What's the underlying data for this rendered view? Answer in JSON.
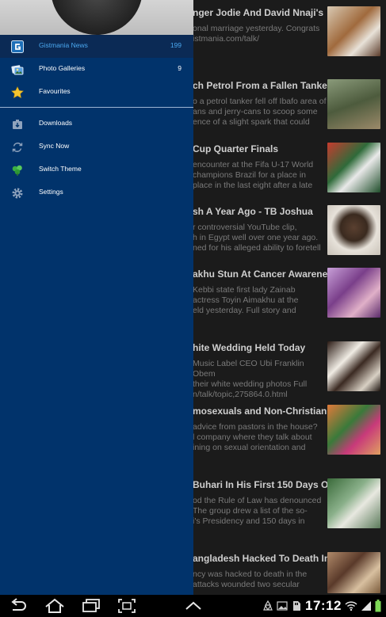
{
  "drawer": {
    "items": [
      {
        "label": "Gistmania News",
        "count": "199",
        "icon": "gistmania-icon",
        "active": true
      },
      {
        "label": "Photo Galleries",
        "count": "9",
        "icon": "photo-galleries-icon"
      },
      {
        "label": "Favourites",
        "count": "",
        "icon": "star-icon"
      },
      {
        "label": "Downloads",
        "count": "",
        "icon": "download-icon"
      },
      {
        "label": "Sync Now",
        "count": "",
        "icon": "sync-icon"
      },
      {
        "label": "Switch Theme",
        "count": "",
        "icon": "theme-icon"
      },
      {
        "label": "Settings",
        "count": "",
        "icon": "settings-icon"
      }
    ]
  },
  "feed": {
    "articles": [
      {
        "headline": "nger Jodie And David Nnaji's",
        "snippet": "onal marriage yesterday. Congrats\nistmania.com/talk/"
      },
      {
        "headline": "ch Petrol From a Fallen Tanker",
        "snippet": "o a petrol tanker fell off Ibafo area of\nans and jerry-cans to scoop some\nence of a slight spark that could"
      },
      {
        "headline": "Cup Quarter Finals",
        "snippet": "encounter at the Fifa U-17 World\n champions Brazil for a place in\nplace in the last eight after a late"
      },
      {
        "headline": "sh A Year Ago - TB Joshua",
        "snippet": "r controversial YouTube clip,\nh in Egypt well over one year ago.\nned for his alleged ability to foretell"
      },
      {
        "headline": "akhu Stun At Cancer Awareness",
        "snippet": "Kebbi state first lady Zainab\nactress Toyin Aimakhu at the\neld yesterday. Full story and"
      },
      {
        "headline": "hite Wedding Held Today",
        "snippet": "Music Label CEO Ubi Franklin Obem\ntheir white wedding photos Full\nn/talk/topic,275864.0.html"
      },
      {
        "headline": "mosexuals and Non-Christian",
        "snippet": " advice from pastors in the house?\nl company where they talk about\nining on sexual orientation and"
      },
      {
        "headline": "Buhari In His First 150 Days Of",
        "snippet": "od the Rule of Law has denounced\n The group drew a list of the so-\ni's Presidency and 150 days in"
      },
      {
        "headline": "angladesh Hacked To Death In",
        "snippet": "ncy was hacked to death in the\nattacks wounded two secular"
      }
    ]
  },
  "statusbar": {
    "time": "17:12"
  },
  "colors": {
    "drawer_bg": "#01336b",
    "active_accent": "#4aa8f0",
    "feed_bg": "#1b1b1b"
  }
}
